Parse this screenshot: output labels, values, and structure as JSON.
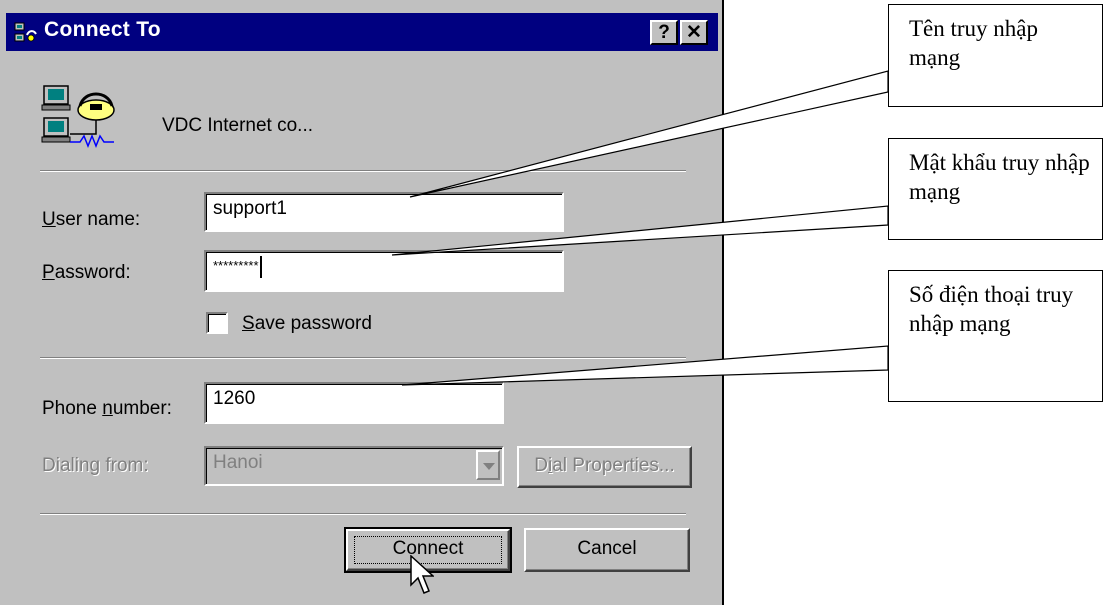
{
  "window": {
    "title": "Connect To",
    "help_button": "?",
    "close_button": "✕"
  },
  "connection": {
    "name": "VDC Internet co...",
    "icon": "dialup-connection-icon"
  },
  "form": {
    "user_name_label": "User name:",
    "user_name_value": "support1",
    "password_label": "Password:",
    "password_value": "*********",
    "save_password_label": "Save password",
    "save_password_checked": false,
    "phone_number_label": "Phone number:",
    "phone_number_value": "1260",
    "dialing_from_label": "Dialing from:",
    "dialing_from_value": "Hanoi",
    "dial_properties_label": "Dial Properties..."
  },
  "buttons": {
    "connect": "Connect",
    "cancel": "Cancel"
  },
  "callouts": {
    "user_name": "Tên truy nhập mạng",
    "password": "Mật khẩu truy nhập mạng",
    "phone": "Số điện thoại truy nhập mạng"
  },
  "colors": {
    "titlebar": "#000080",
    "dialog_face": "#c0c0c0"
  }
}
